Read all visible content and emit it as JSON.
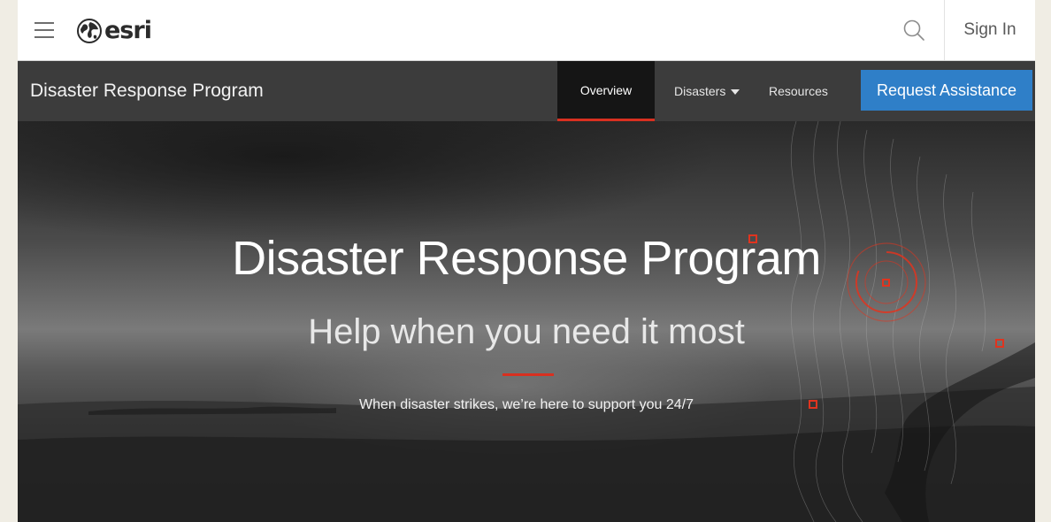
{
  "brand": {
    "name": "esri"
  },
  "header": {
    "sign_in_label": "Sign In",
    "icons": {
      "menu": "hamburger-menu-icon",
      "search": "search-icon",
      "logo": "esri-globe-logo"
    }
  },
  "subnav": {
    "title": "Disaster Response Program",
    "items": [
      {
        "label": "Overview",
        "active": true
      },
      {
        "label": "Disasters",
        "has_dropdown": true
      },
      {
        "label": "Resources"
      }
    ],
    "cta_label": "Request Assistance"
  },
  "hero": {
    "title": "Disaster Response Program",
    "subtitle": "Help when you need it most",
    "tagline": "When disaster strikes, we’re here to support you 24/7"
  },
  "colors": {
    "accent_red": "#d83020",
    "cta_blue": "#2f7fc8",
    "subnav_bg": "#3c3c3c",
    "active_tab_bg": "#151515",
    "page_bg": "#f0ede4"
  }
}
